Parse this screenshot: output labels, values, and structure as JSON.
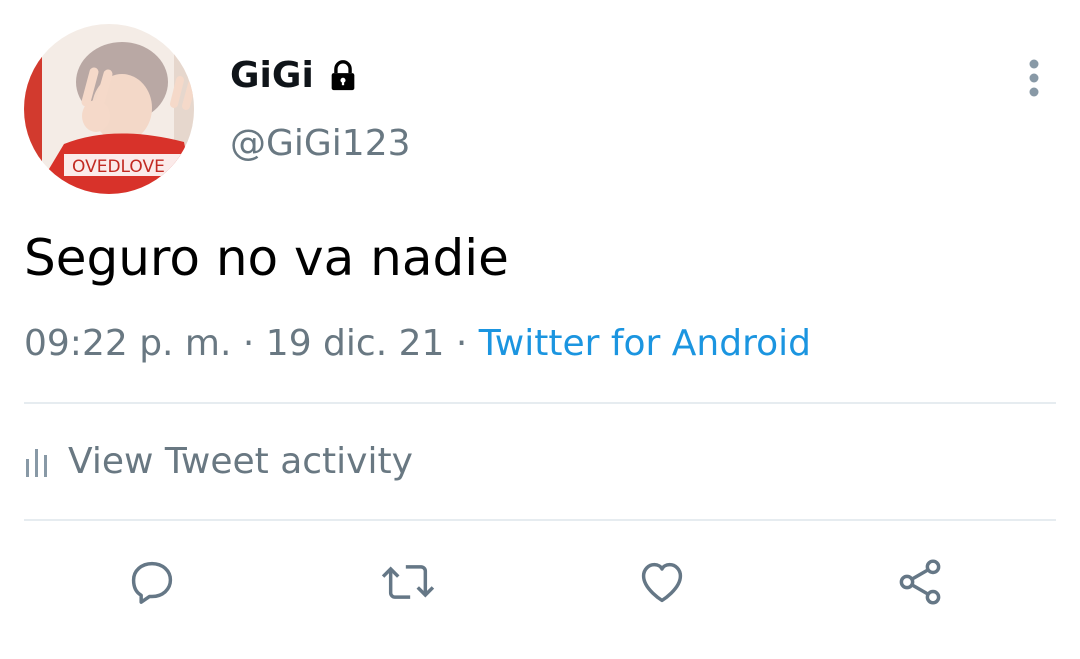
{
  "tweet": {
    "display_name": "GiGi",
    "handle": "@GiGi123",
    "text": "Seguro no va nadie",
    "time": "09:22 p. m.",
    "date": "19 dic. 21",
    "source": "Twitter for Android",
    "separator": " · "
  },
  "activity": {
    "label": "View Tweet activity"
  },
  "avatar": {
    "shirt_text": "OVEDLOVE"
  },
  "colors": {
    "link": "#1b95e0",
    "secondary": "#697882",
    "divider": "#e6ecf0"
  },
  "icons": {
    "lock": "lock-icon",
    "more": "more-vertical-icon",
    "activity": "bar-chart-icon",
    "reply": "reply-icon",
    "retweet": "retweet-icon",
    "like": "heart-icon",
    "share": "share-icon"
  }
}
